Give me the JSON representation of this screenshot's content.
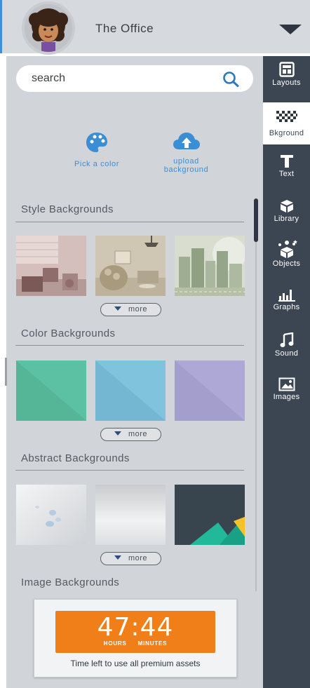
{
  "header": {
    "title": "The Office",
    "avatar_icon": "cartoon-woman-avatar",
    "menu_icon": "caret-down-icon"
  },
  "search": {
    "placeholder": "search",
    "icon": "search-icon"
  },
  "tools": {
    "pick_color_label": "Pick a color",
    "upload_label_line1": "upload",
    "upload_label_line2": "background",
    "accent_color": "#3b8ed3"
  },
  "sections": [
    {
      "title": "Style Backgrounds",
      "more_label": "more"
    },
    {
      "title": "Color Backgrounds",
      "more_label": "more"
    },
    {
      "title": "Abstract Backgrounds",
      "more_label": "more"
    },
    {
      "title": "Image Backgrounds"
    }
  ],
  "color_swatches": [
    "#5cc0a2",
    "#7fc3dd",
    "#aea8d6"
  ],
  "timer": {
    "digits": "47:44",
    "unit_hours": "HOURS",
    "unit_minutes": "MINUTES",
    "caption": "Time left to use all premium assets",
    "color": "#f07f1a"
  },
  "rail": {
    "items": [
      {
        "label": "Layouts",
        "icon": "layouts-icon"
      },
      {
        "label": "Bkground",
        "icon": "checkerboard-icon",
        "active": true
      },
      {
        "label": "Text",
        "icon": "text-icon"
      },
      {
        "label": "Library",
        "icon": "box-icon"
      },
      {
        "label": "Objects",
        "icon": "objects-icon"
      },
      {
        "label": "Graphs",
        "icon": "bar-graph-icon"
      },
      {
        "label": "Sound",
        "icon": "music-note-icon"
      },
      {
        "label": "Images",
        "icon": "image-icon"
      }
    ],
    "background": "#3c4552"
  }
}
